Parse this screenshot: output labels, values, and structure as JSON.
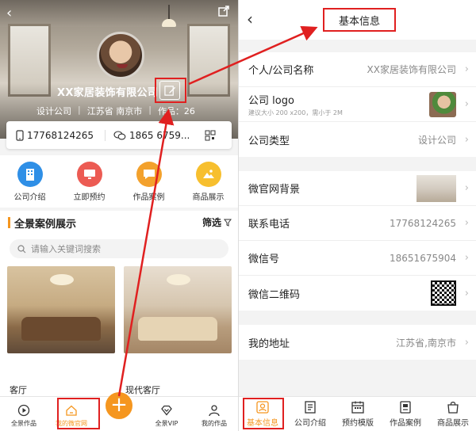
{
  "left": {
    "company_name": "XX家居装饰有限公司",
    "company_type": "设计公司",
    "location": "江苏省 南京市",
    "works": "作品：26",
    "phone": "17768124265",
    "wechat": "1865 6759...",
    "quick_actions": [
      {
        "label": "公司介绍",
        "color": "#2f8fe6"
      },
      {
        "label": "立即预约",
        "color": "#ec5b53"
      },
      {
        "label": "作品案例",
        "color": "#f3a12c"
      },
      {
        "label": "商品展示",
        "color": "#f7bf2e"
      }
    ],
    "section_title": "全景案例展示",
    "filter_label": "筛选",
    "search_placeholder": "请输入关键词搜索",
    "cards": [
      {
        "label": "客厅"
      },
      {
        "label": "现代客厅"
      }
    ],
    "tabs": [
      {
        "label": "全景作品",
        "icon": "play-circle-icon"
      },
      {
        "label": "我的微官网",
        "icon": "home-icon",
        "active": true
      },
      {
        "label": "",
        "icon": "plus-icon"
      },
      {
        "label": "全景VIP",
        "icon": "vip-diamond-icon"
      },
      {
        "label": "我的作品",
        "icon": "user-icon"
      }
    ],
    "accent": "#f5961f"
  },
  "right": {
    "title": "基本信息",
    "rows_group1": [
      {
        "label": "个人/公司名称",
        "value": "XX家居装饰有限公司"
      },
      {
        "label": "公司 logo",
        "hint": "建议大小 200 x200，需小于 2M",
        "value": ""
      },
      {
        "label": "公司类型",
        "value": "设计公司"
      }
    ],
    "rows_group2": [
      {
        "label": "微官网背景",
        "value": ""
      },
      {
        "label": "联系电话",
        "value": "17768124265"
      },
      {
        "label": "微信号",
        "value": "18651675904"
      },
      {
        "label": "微信二维码",
        "value": ""
      }
    ],
    "rows_group3": [
      {
        "label": "我的地址",
        "value": "江苏省,南京市"
      }
    ],
    "tabs": [
      {
        "label": "基本信息",
        "icon": "user-card-icon",
        "active": true
      },
      {
        "label": "公司介绍",
        "icon": "building-doc-icon"
      },
      {
        "label": "预约模版",
        "icon": "calendar-icon"
      },
      {
        "label": "作品案例",
        "icon": "case-doc-icon"
      },
      {
        "label": "商品展示",
        "icon": "shopping-bag-icon"
      }
    ]
  },
  "annotation_color": "#e02020"
}
